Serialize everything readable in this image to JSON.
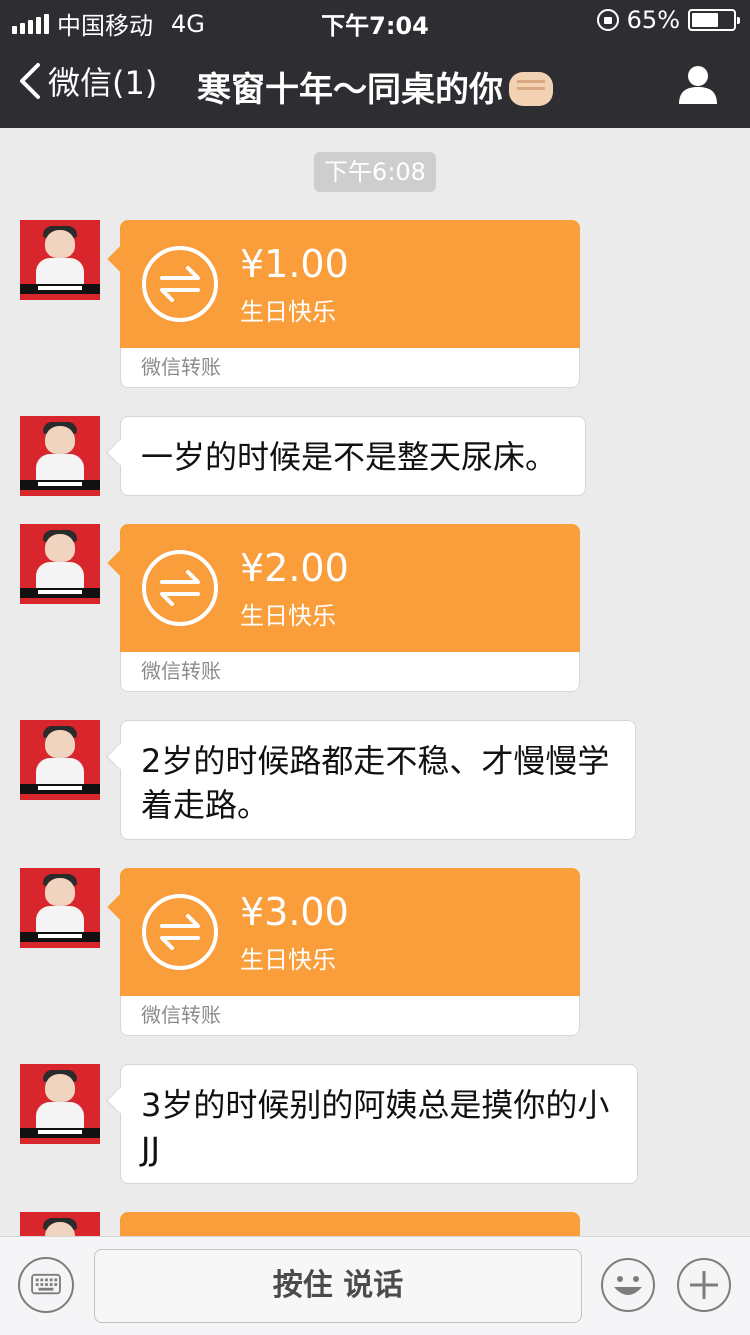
{
  "status": {
    "carrier": "中国移动",
    "network": "4G",
    "time": "下午7:04",
    "battery_text": "65%",
    "battery_level": 0.65
  },
  "nav": {
    "back_label": "微信(1)",
    "title": "寒窗十年～同桌的你",
    "title_emoji": "fist-bump",
    "profile_icon": "person-icon"
  },
  "chat": {
    "timestamp": "下午6:08",
    "messages": [
      {
        "type": "transfer",
        "amount": "¥1.00",
        "note": "生日快乐",
        "footer": "微信转账"
      },
      {
        "type": "text",
        "text": "一岁的时候是不是整天尿床。"
      },
      {
        "type": "transfer",
        "amount": "¥2.00",
        "note": "生日快乐",
        "footer": "微信转账"
      },
      {
        "type": "text",
        "text": "2岁的时候路都走不稳、才慢慢学着走路。"
      },
      {
        "type": "transfer",
        "amount": "¥3.00",
        "note": "生日快乐",
        "footer": "微信转账"
      },
      {
        "type": "text",
        "text": "3岁的时候别的阿姨总是摸你的小JJ"
      }
    ]
  },
  "input": {
    "hold_label": "按住 说话"
  },
  "colors": {
    "transfer_orange": "#f99e3a",
    "nav_bg": "#2e2e32",
    "chat_bg": "#ebebeb"
  }
}
